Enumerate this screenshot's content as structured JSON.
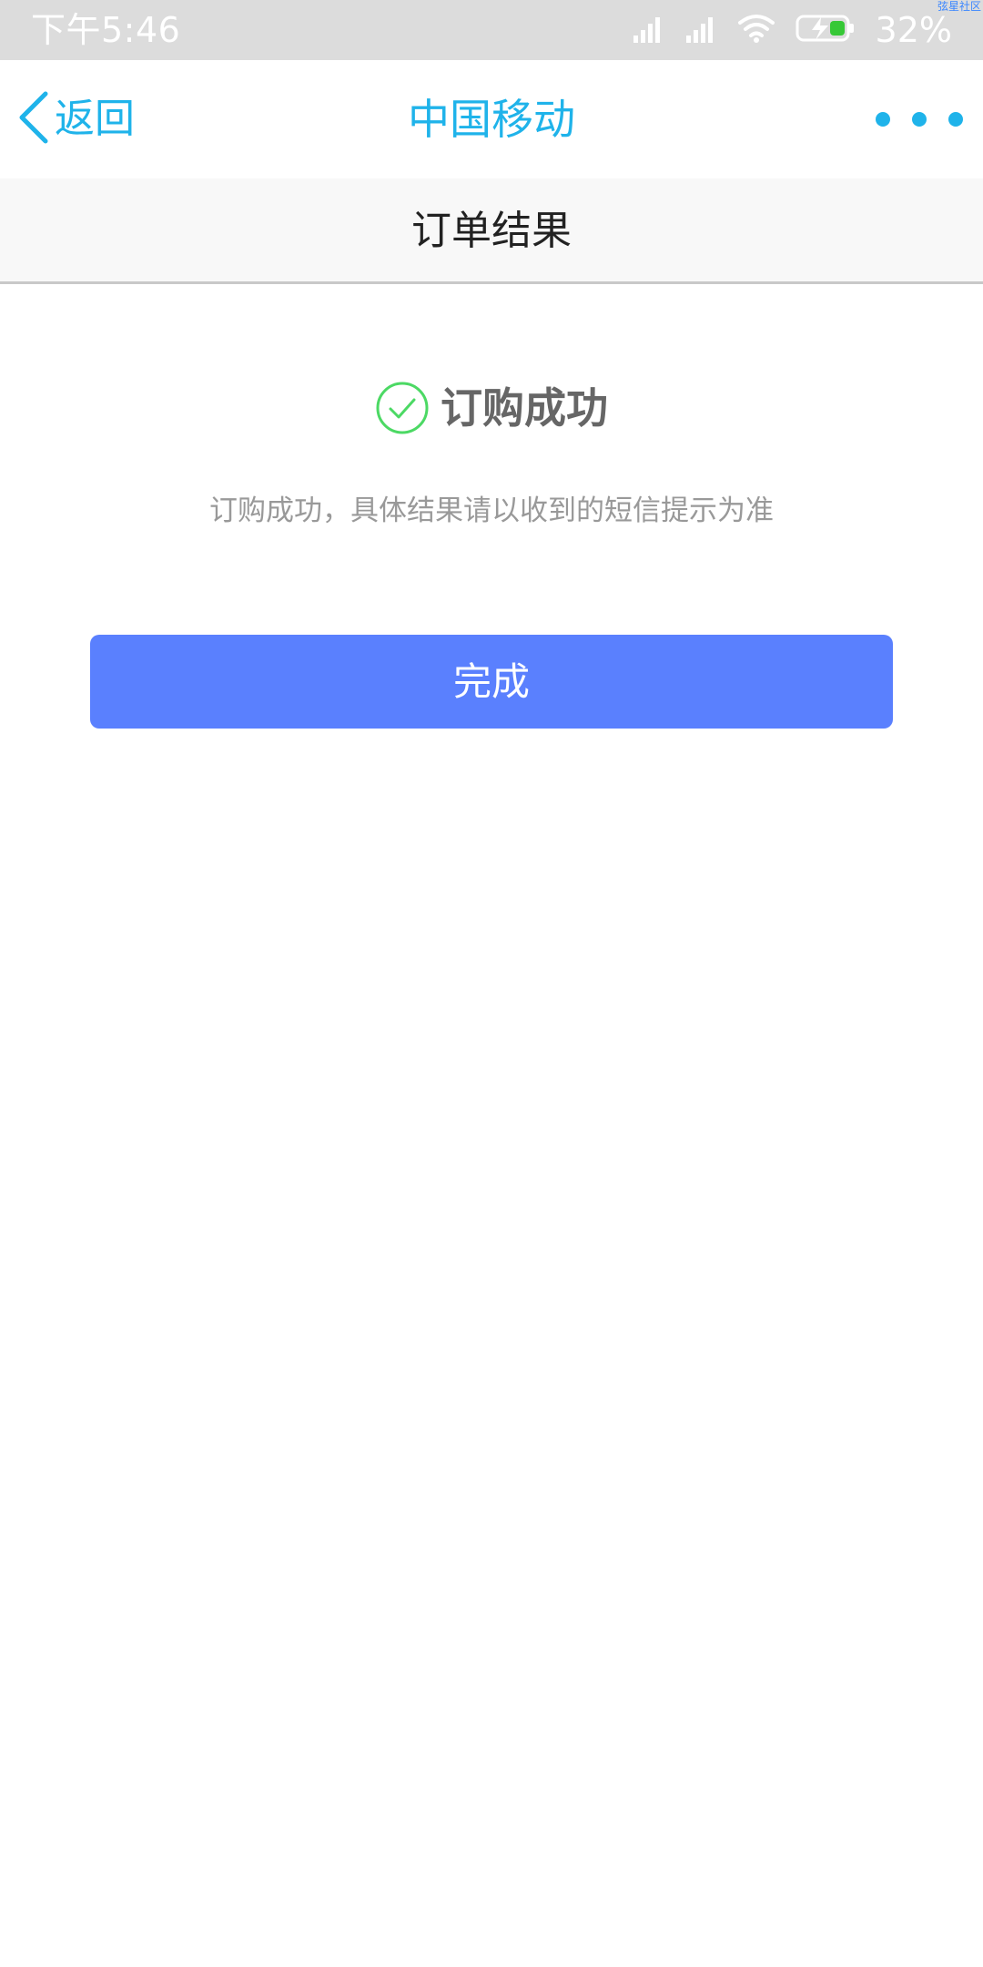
{
  "status_bar": {
    "time": "下午5:46",
    "battery_percent": "32%",
    "watermark": "弦星社区",
    "icons": [
      "signal-icon",
      "signal-icon",
      "wifi-icon",
      "battery-charging-icon"
    ]
  },
  "nav": {
    "back_label": "返回",
    "title": "中国移动",
    "more_icon": "more-dots-icon"
  },
  "sub_header": {
    "title": "订单结果"
  },
  "result": {
    "icon": "check-circle-icon",
    "title": "订购成功",
    "description": "订购成功，具体结果请以收到的短信提示为准"
  },
  "actions": {
    "done_label": "完成"
  },
  "colors": {
    "accent": "#1fb3ea",
    "button": "#5a80fe",
    "success": "#4cd964",
    "status_bar_bg": "#dcdcdc",
    "battery_fill": "#37c837"
  }
}
